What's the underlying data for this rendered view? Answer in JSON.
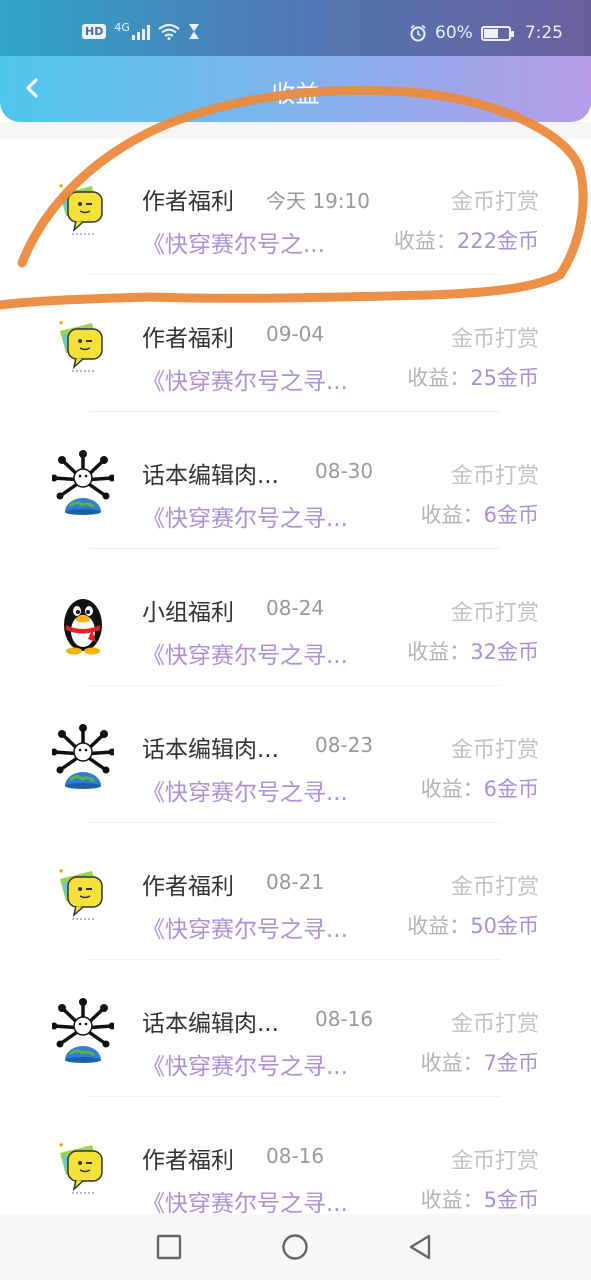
{
  "status_bar": {
    "hd": "HD",
    "network": "4G",
    "battery": "60%",
    "battery_level": 0.6,
    "time": "7:25"
  },
  "header": {
    "title": "收益",
    "back_icon": "chevron-left-icon"
  },
  "labels": {
    "earn_prefix": "收益：",
    "earn_suffix": "金币"
  },
  "items": [
    {
      "name": "作者福利",
      "date": "今天 19:10",
      "kind": "金币打赏",
      "book": "《快穿赛尔号之...",
      "earn_amount": "222",
      "avatar": "sticker-icon"
    },
    {
      "name": "作者福利",
      "date": "09-04",
      "kind": "金币打赏",
      "book": "《快穿赛尔号之寻...",
      "earn_amount": "25",
      "avatar": "sticker-icon"
    },
    {
      "name": "话本编辑肉...",
      "date": "08-30",
      "kind": "金币打赏",
      "book": "《快穿赛尔号之寻...",
      "earn_amount": "6",
      "avatar": "globe-character-icon"
    },
    {
      "name": "小组福利",
      "date": "08-24",
      "kind": "金币打赏",
      "book": "《快穿赛尔号之寻...",
      "earn_amount": "32",
      "avatar": "penguin-icon"
    },
    {
      "name": "话本编辑肉...",
      "date": "08-23",
      "kind": "金币打赏",
      "book": "《快穿赛尔号之寻...",
      "earn_amount": "6",
      "avatar": "globe-character-icon"
    },
    {
      "name": "作者福利",
      "date": "08-21",
      "kind": "金币打赏",
      "book": "《快穿赛尔号之寻...",
      "earn_amount": "50",
      "avatar": "sticker-icon"
    },
    {
      "name": "话本编辑肉...",
      "date": "08-16",
      "kind": "金币打赏",
      "book": "《快穿赛尔号之寻...",
      "earn_amount": "7",
      "avatar": "globe-character-icon"
    },
    {
      "name": "作者福利",
      "date": "08-16",
      "kind": "金币打赏",
      "book": "《快穿赛尔号之寻...",
      "earn_amount": "5",
      "avatar": "sticker-icon"
    }
  ],
  "nav": {
    "recents_icon": "square-icon",
    "home_icon": "circle-icon",
    "back_icon": "triangle-back-icon"
  },
  "colors": {
    "accent_purple": "#a98fd6",
    "highlight_annotation": "#ea8a3c"
  }
}
